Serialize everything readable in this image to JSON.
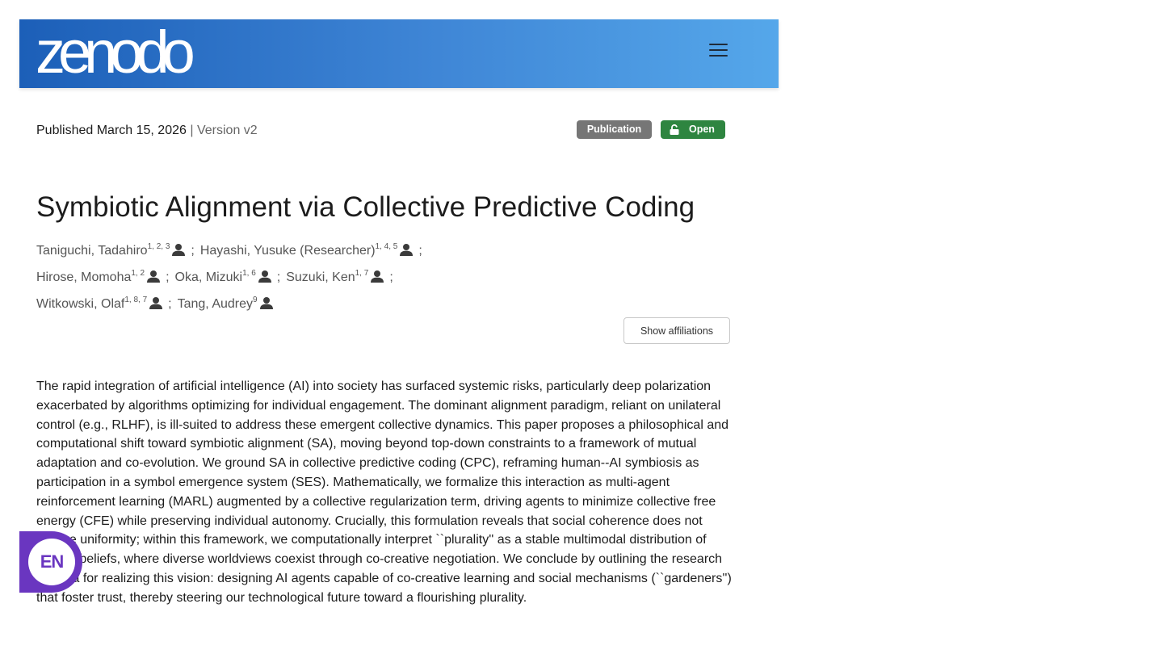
{
  "header": {
    "logo_text": "zenodo",
    "menu_icon": "hamburger-menu-icon",
    "colors": {
      "gradient_start": "#1c5fb8",
      "gradient_end": "#55a7ea"
    }
  },
  "meta": {
    "published": "Published March 15, 2026",
    "separator": "|",
    "version": "Version v2"
  },
  "badges": {
    "type": "Publication",
    "access": "Open",
    "access_icon": "unlock-icon",
    "type_color": "#767676",
    "access_color": "#2e8540"
  },
  "record": {
    "title": "Symbiotic Alignment via Collective Predictive Coding"
  },
  "authors": [
    {
      "name": "Taniguchi, Tadahiro",
      "affiliations": "1, 2, 3"
    },
    {
      "name": "Hayashi, Yusuke (Researcher)",
      "affiliations": "1, 4, 5"
    },
    {
      "name": "Hirose, Momoha",
      "affiliations": "1, 2"
    },
    {
      "name": "Oka, Mizuki",
      "affiliations": "1, 6"
    },
    {
      "name": "Suzuki, Ken",
      "affiliations": "1, 7"
    },
    {
      "name": "Witkowski, Olaf",
      "affiliations": "1, 8, 7"
    },
    {
      "name": "Tang, Audrey",
      "affiliations": "9"
    }
  ],
  "author_separator": ";",
  "show_affiliations_label": "Show affiliations",
  "abstract": "The rapid integration of artificial intelligence (AI) into society has surfaced systemic risks, particularly deep polarization exacerbated by algorithms optimizing for individual engagement. The dominant alignment paradigm, reliant on unilateral control (e.g., RLHF), is ill-suited to address these emergent collective dynamics. This paper proposes a philosophical and computational shift toward symbiotic alignment (SA), moving beyond top-down constraints to a framework of mutual adaptation and co-evolution. We ground SA in collective predictive coding (CPC), reframing human--AI symbiosis as participation in a symbol emergence system (SES). Mathematically, we formalize this interaction as multi-agent reinforcement learning (MARL) augmented by a collective regularization term, driving agents to minimize collective free energy (CFE) while preserving individual autonomy. Crucially, this formulation reveals that social coherence does not require uniformity; within this framework, we computationally interpret ``plurality'' as a stable multimodal distribution of shared beliefs, where diverse worldviews coexist through co-creative negotiation. We conclude by outlining the research agenda for realizing this vision: designing AI agents capable of co-creative learning and social mechanisms (``gardeners'') that foster trust, thereby steering our technological future toward a flourishing plurality.",
  "language_widget": {
    "label": "EN",
    "color": "#6a36c0"
  }
}
